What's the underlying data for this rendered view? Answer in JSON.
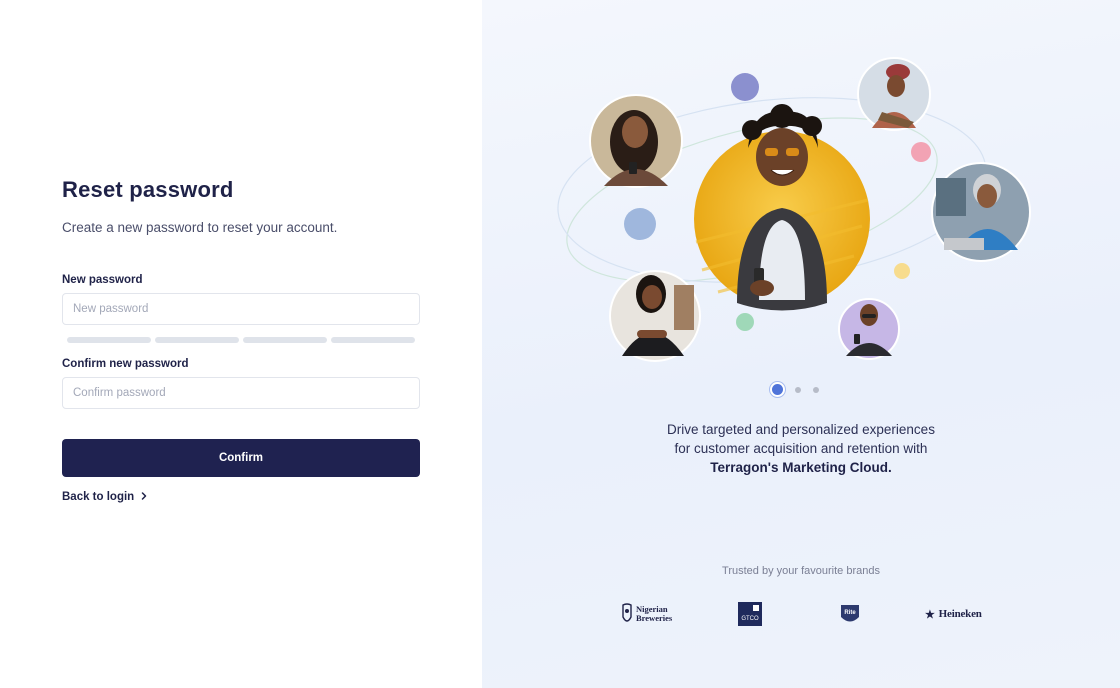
{
  "form": {
    "title": "Reset password",
    "subtitle": "Create a new password to reset your account.",
    "new_password": {
      "label": "New password",
      "placeholder": "New password",
      "value": ""
    },
    "confirm_password": {
      "label": "Confirm new password",
      "placeholder": "Confirm password",
      "value": ""
    },
    "strength_segments": 4,
    "confirm_label": "Confirm",
    "back_label": "Back to login"
  },
  "showcase": {
    "carousel": {
      "slides": 3,
      "active_index": 0
    },
    "tagline_line1": "Drive targeted and personalized experiences",
    "tagline_line2": "for customer acquisition and retention with",
    "tagline_strong": "Terragon's Marketing Cloud.",
    "trusted_text": "Trusted by your favourite brands",
    "brands": {
      "nigerian_line1": "Nigerian",
      "nigerian_line2": "Breweries",
      "gtco": "GTCO",
      "rite": "Rite",
      "heineken": "Heineken"
    }
  },
  "colors": {
    "primary": "#1f2250",
    "accent_blue": "#4f74d9",
    "bubble_purple": "#8b90cf",
    "bubble_blue": "#9fb7dd",
    "bubble_pink": "#f2a3b4",
    "bubble_yellow": "#f7dc8e",
    "bubble_green": "#9fd8b8"
  }
}
